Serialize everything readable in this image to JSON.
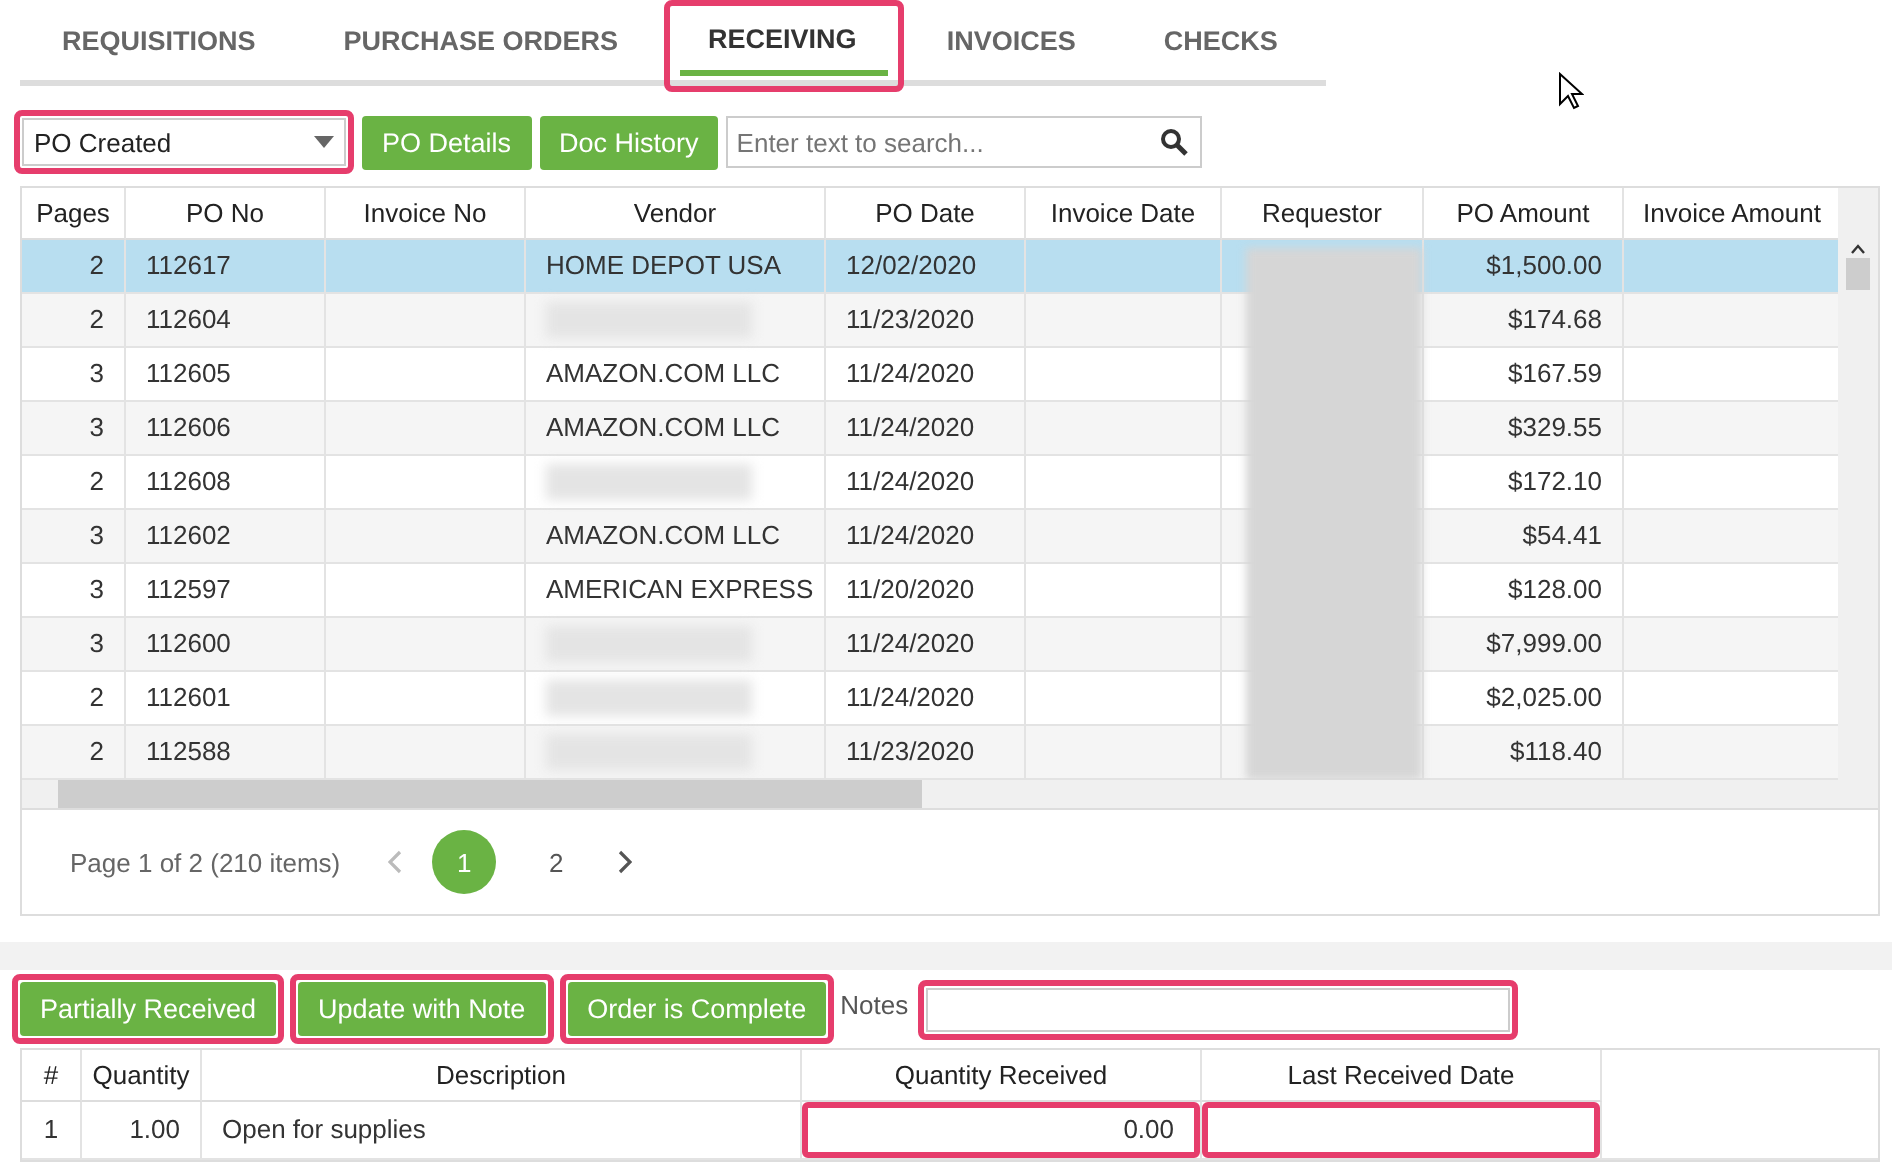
{
  "tabs": [
    {
      "label": "REQUISITIONS",
      "selected": false,
      "highlighted": false
    },
    {
      "label": "PURCHASE ORDERS",
      "selected": false,
      "highlighted": false
    },
    {
      "label": "RECEIVING",
      "selected": true,
      "highlighted": true
    },
    {
      "label": "INVOICES",
      "selected": false,
      "highlighted": false
    },
    {
      "label": "CHECKS",
      "selected": false,
      "highlighted": false
    }
  ],
  "toolbar": {
    "status_filter": {
      "value": "PO Created",
      "highlighted": true
    },
    "buttons": [
      "PO Details",
      "Doc History"
    ],
    "search": {
      "placeholder": "Enter text to search..."
    }
  },
  "table": {
    "columns": [
      "Pages",
      "PO No",
      "Invoice No",
      "Vendor",
      "PO Date",
      "Invoice Date",
      "Requestor",
      "PO Amount",
      "Invoice Amount"
    ],
    "rows": [
      {
        "pages": "2",
        "po_no": "112617",
        "vendor": "HOME DEPOT USA",
        "vendor_blurred": false,
        "po_date": "12/02/2020",
        "po_amount": "$1,500.00",
        "selected": true
      },
      {
        "pages": "2",
        "po_no": "112604",
        "vendor_blurred": true,
        "po_date": "11/23/2020",
        "po_amount": "$174.68",
        "selected": false
      },
      {
        "pages": "3",
        "po_no": "112605",
        "vendor": "AMAZON.COM LLC",
        "vendor_blurred": false,
        "po_date": "11/24/2020",
        "po_amount": "$167.59",
        "selected": false
      },
      {
        "pages": "3",
        "po_no": "112606",
        "vendor": "AMAZON.COM LLC",
        "vendor_blurred": false,
        "po_date": "11/24/2020",
        "po_amount": "$329.55",
        "selected": false
      },
      {
        "pages": "2",
        "po_no": "112608",
        "vendor_blurred": true,
        "po_date": "11/24/2020",
        "po_amount": "$172.10",
        "selected": false
      },
      {
        "pages": "3",
        "po_no": "112602",
        "vendor": "AMAZON.COM LLC",
        "vendor_blurred": false,
        "po_date": "11/24/2020",
        "po_amount": "$54.41",
        "selected": false
      },
      {
        "pages": "3",
        "po_no": "112597",
        "vendor": "AMERICAN EXPRESS",
        "vendor_blurred": false,
        "po_date": "11/20/2020",
        "po_amount": "$128.00",
        "selected": false
      },
      {
        "pages": "3",
        "po_no": "112600",
        "vendor_blurred": true,
        "po_date": "11/24/2020",
        "po_amount": "$7,999.00",
        "selected": false
      },
      {
        "pages": "2",
        "po_no": "112601",
        "vendor_blurred": true,
        "po_date": "11/24/2020",
        "po_amount": "$2,025.00",
        "selected": false
      },
      {
        "pages": "2",
        "po_no": "112588",
        "vendor_blurred": true,
        "po_date": "11/23/2020",
        "po_amount": "$118.40",
        "selected": false
      }
    ]
  },
  "pager": {
    "info": "Page 1 of 2 (210 items)",
    "pages": [
      {
        "label": "1",
        "selected": true
      },
      {
        "label": "2",
        "selected": false
      }
    ]
  },
  "actions": [
    {
      "label": "Partially Received",
      "highlighted": true
    },
    {
      "label": "Update with Note",
      "highlighted": true
    },
    {
      "label": "Order is Complete",
      "highlighted": true
    }
  ],
  "notes": {
    "label": "Notes",
    "highlighted": true
  },
  "lines": {
    "columns": [
      "#",
      "Quantity",
      "Description",
      "Quantity Received",
      "Last Received Date"
    ],
    "rows": [
      {
        "number": "1",
        "quantity": "1.00",
        "description": "Open for supplies",
        "quantity_received": "0.00",
        "highlighted": true
      }
    ]
  }
}
